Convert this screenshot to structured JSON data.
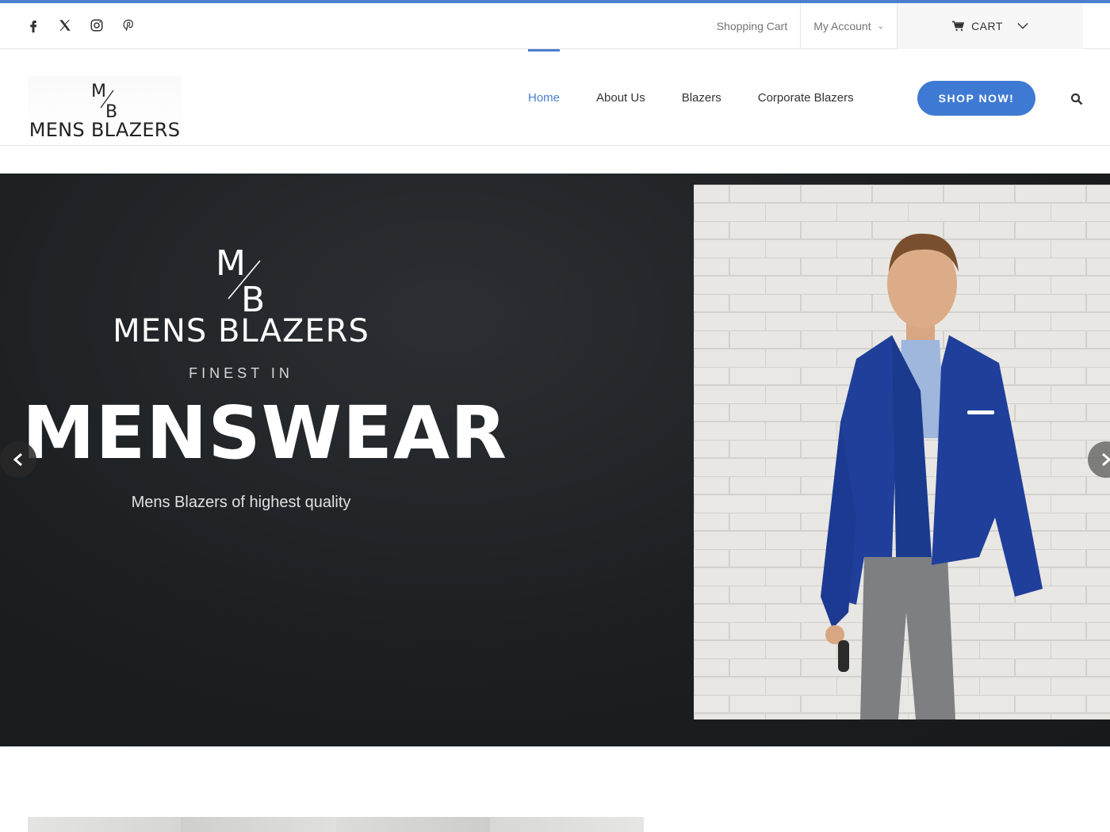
{
  "topbar": {
    "social": [
      "facebook-icon",
      "x-icon",
      "instagram-icon",
      "pinterest-icon"
    ],
    "links": [
      {
        "label": "Shopping Cart"
      },
      {
        "label": "My Account"
      }
    ],
    "cart_label": "CART"
  },
  "header": {
    "logo_monogram": "M/B",
    "logo_text": "MENS BLAZERS",
    "nav": [
      {
        "label": "Home",
        "active": true
      },
      {
        "label": "About Us"
      },
      {
        "label": "Blazers"
      },
      {
        "label": "Corporate Blazers"
      }
    ],
    "cta_label": "SHOP NOW!"
  },
  "hero": {
    "brand": "MENS BLAZERS",
    "kicker": "FINEST IN",
    "title": "MENSWEAR",
    "subtitle": "Mens Blazers of highest quality"
  },
  "colors": {
    "accent": "#4a7fcf",
    "button": "#3e7ad3",
    "hero_bg": "#1c1f22",
    "blazer": "#1f3f9a"
  }
}
